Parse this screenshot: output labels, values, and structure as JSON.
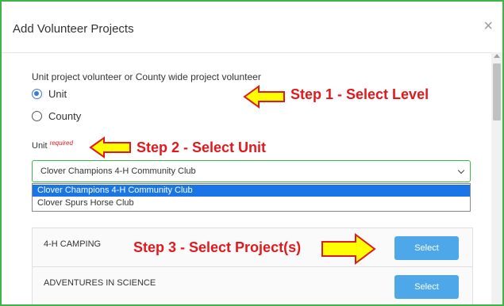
{
  "modal": {
    "title": "Add Volunteer Projects",
    "close_glyph": "×"
  },
  "level": {
    "question": "Unit project volunteer or County wide project volunteer",
    "options": [
      {
        "label": "Unit",
        "checked": true
      },
      {
        "label": "County",
        "checked": false
      }
    ]
  },
  "unit": {
    "label": "Unit",
    "required_text": "required",
    "selected_value": "Clover Champions 4-H Community Club",
    "options": [
      "Clover Champions 4-H Community Club",
      "Clover Spurs Horse Club"
    ]
  },
  "projects": [
    {
      "name": "4-H CAMPING",
      "button": "Select"
    },
    {
      "name": "ADVENTURES IN SCIENCE",
      "button": "Select"
    }
  ],
  "annotations": {
    "step1": "Step 1 - Select Level",
    "step2": "Step 2 - Select Unit",
    "step3": "Step 3 - Select Project(s)"
  },
  "colors": {
    "frame_border": "#3fb549",
    "accent_blue": "#4da7e8",
    "callout_red": "#e0191d",
    "arrow_yellow": "#ffff00"
  }
}
